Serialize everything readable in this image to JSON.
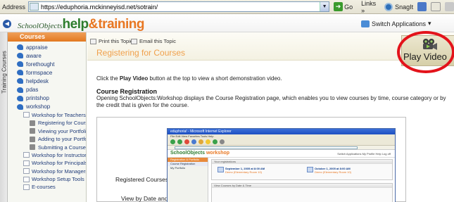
{
  "browser": {
    "address_label": "Address",
    "url": "https://eduphoria.mckinneyisd.net/sotrain/",
    "go_label": "Go",
    "links_label": "Links",
    "links_chevron": "»",
    "snagit_label": "SnagIt",
    "dropdown_glyph": "▼"
  },
  "header": {
    "logo_school": "SchoolObjects",
    "logo_help": "help",
    "logo_amp": "&",
    "logo_training": "training",
    "switch_apps_label": "Switch Applications",
    "switch_apps_caret": "▾"
  },
  "side_tab": {
    "label": "Training Courses"
  },
  "sidebar": {
    "title": "Courses",
    "items": [
      {
        "label": "appraise"
      },
      {
        "label": "aware"
      },
      {
        "label": "forethought"
      },
      {
        "label": "formspace"
      },
      {
        "label": "helpdesk"
      },
      {
        "label": "pdas"
      },
      {
        "label": "printshop"
      },
      {
        "label": "workshop"
      }
    ],
    "sub_items": [
      {
        "label": "Workshop for Teachers"
      },
      {
        "label": "Registering for Courses"
      },
      {
        "label": "Viewing your Portfolio"
      },
      {
        "label": "Adding to your Portfolio"
      },
      {
        "label": "Submitting a Course"
      },
      {
        "label": "Workshop for Instructors"
      },
      {
        "label": "Workshop for Principals"
      },
      {
        "label": "Workshop for Managers"
      },
      {
        "label": "Workshop Setup Tools"
      },
      {
        "label": "E-courses"
      }
    ]
  },
  "topic": {
    "print_label": "Print this Topic",
    "email_label": "Email this Topic",
    "title": "Registering for Courses",
    "play_video_label": "Play Video",
    "instruction_pre": "Click the ",
    "instruction_bold": "Play Video",
    "instruction_post": " button at the top to view a short demonstration video.",
    "section_title": "Course Registration",
    "section_body": "Opening SchoolObjects:Workshop displays the Course Registration page, which enables you to view courses by time, course category or by the credit that is given for the course."
  },
  "figure": {
    "label_registered": "Registered Courses",
    "label_view": "View by Date and",
    "mini_window_title": "eduphoria! - Microsoft Internet Explorer",
    "mini_menu": "File   Edit   View   Favorites   Tools   Help",
    "mini_logo_a": "SchoolObjects ",
    "mini_logo_b": "workshop",
    "mini_apps": "Switch Applications   My Profile   Help   Log off",
    "mini_side_rows": [
      "Registration & Portfolio",
      "Course Registration",
      "My Portfolio"
    ],
    "mini_panel1_title": "Your registrations",
    "mini_panel2_title": "View Courses by Date & Time",
    "course_1": {
      "date": "September 1, 2005 at 8:00 AM",
      "place": "Demo (Elementary Room 10)"
    },
    "course_2": {
      "date": "October 1, 2005 at 8:00 AM",
      "place": "Demo (Elementary Room 10)"
    }
  },
  "colors": {
    "accent_orange": "#e87722",
    "brand_green": "#2e7d2e",
    "highlight_ring": "#e3131b",
    "nav_blue": "#1e3a78"
  }
}
